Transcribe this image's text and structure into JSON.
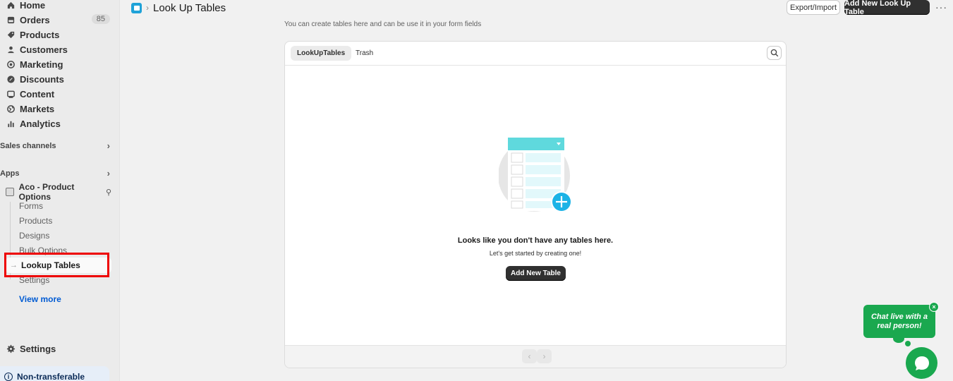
{
  "sidebar": {
    "nav": [
      {
        "label": "Home",
        "icon": "home-icon"
      },
      {
        "label": "Orders",
        "icon": "orders-icon",
        "badge": "85"
      },
      {
        "label": "Products",
        "icon": "tag-icon"
      },
      {
        "label": "Customers",
        "icon": "person-icon"
      },
      {
        "label": "Marketing",
        "icon": "target-icon"
      },
      {
        "label": "Discounts",
        "icon": "discount-icon"
      },
      {
        "label": "Content",
        "icon": "content-icon"
      },
      {
        "label": "Markets",
        "icon": "globe-icon"
      },
      {
        "label": "Analytics",
        "icon": "bar-chart-icon"
      }
    ],
    "sales_channels": "Sales channels",
    "apps": "Apps",
    "app_name": "Aco - Product Options",
    "app_subitems": [
      "Forms",
      "Products",
      "Designs",
      "Bulk Options"
    ],
    "active_item": "Lookup Tables",
    "after_active": "Settings",
    "view_more": "View more",
    "settings": "Settings",
    "banner": "Non-transferable"
  },
  "header": {
    "title": "Look Up Tables",
    "export_label": "Export/Import",
    "add_label": "Add New Look Up Table",
    "subtitle": "You can create tables here and can be use it in your form fields"
  },
  "card": {
    "tabs": [
      "LookUpTables",
      "Trash"
    ],
    "empty_title": "Looks like you don't have any tables here.",
    "empty_sub": "Let's get started by creating one!",
    "add_table_label": "Add New Table"
  },
  "chat": {
    "bubble": "Chat live with a real person!",
    "close": "×"
  },
  "colors": {
    "accent_dark": "#303030",
    "chat_green": "#1aa84f",
    "highlight_red": "#e00000",
    "link_blue": "#005bd3"
  }
}
